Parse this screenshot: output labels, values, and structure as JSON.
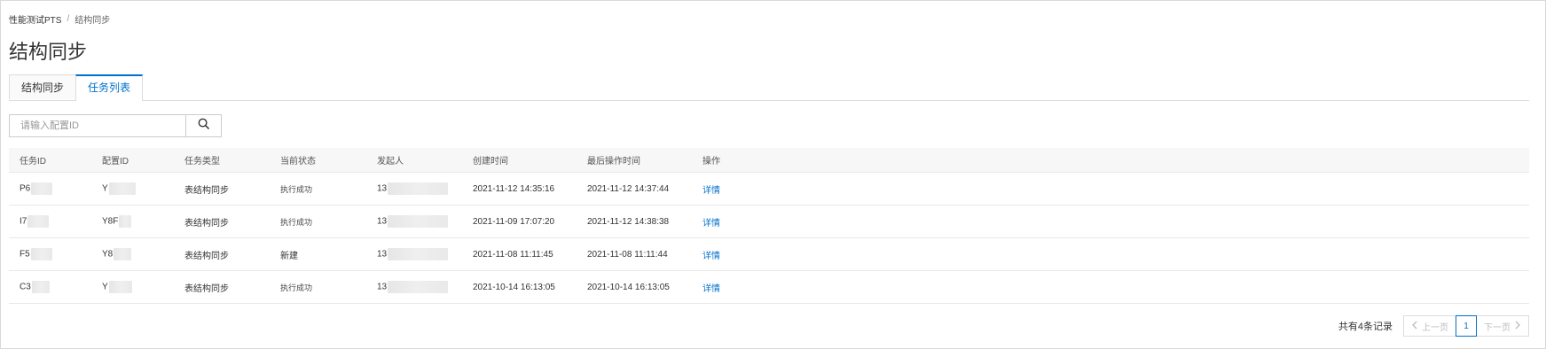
{
  "breadcrumb": {
    "root": "性能测试PTS",
    "separator": "/",
    "current": "结构同步"
  },
  "page": {
    "title": "结构同步"
  },
  "tabs": [
    {
      "label": "结构同步",
      "active": false
    },
    {
      "label": "任务列表",
      "active": true
    }
  ],
  "search": {
    "placeholder": "请输入配置ID",
    "value": ""
  },
  "table": {
    "columns": [
      "任务ID",
      "配置ID",
      "任务类型",
      "当前状态",
      "发起人",
      "创建时间",
      "最后操作时间",
      "操作"
    ],
    "rows": [
      {
        "task_id": "P6",
        "config_id": "Y",
        "task_type": "表结构同步",
        "status": "执行成功",
        "initiator": "13",
        "created": "2021-11-12 14:35:16",
        "last_op": "2021-11-12 14:37:44",
        "action": "详情"
      },
      {
        "task_id": "I7",
        "config_id": "Y8F",
        "task_type": "表结构同步",
        "status": "执行成功",
        "initiator": "13",
        "created": "2021-11-09 17:07:20",
        "last_op": "2021-11-12 14:38:38",
        "action": "详情"
      },
      {
        "task_id": "F5",
        "config_id": "Y8",
        "task_type": "表结构同步",
        "status": "新建",
        "initiator": "13",
        "created": "2021-11-08 11:11:45",
        "last_op": "2021-11-08 11:11:44",
        "action": "详情"
      },
      {
        "task_id": "C3",
        "config_id": "Y",
        "task_type": "表结构同步",
        "status": "执行成功",
        "initiator": "13",
        "created": "2021-10-14 16:13:05",
        "last_op": "2021-10-14 16:13:05",
        "action": "详情"
      }
    ]
  },
  "pagination": {
    "total_text": "共有4条记录",
    "prev_label": "上一页",
    "next_label": "下一页",
    "current_page": "1"
  },
  "colors": {
    "accent": "#0070cc",
    "border": "#dddddd",
    "header_bg": "#f7f7f7"
  },
  "icons": {
    "search": "search-icon",
    "prev": "chevron-left-icon",
    "next": "chevron-right-icon"
  }
}
